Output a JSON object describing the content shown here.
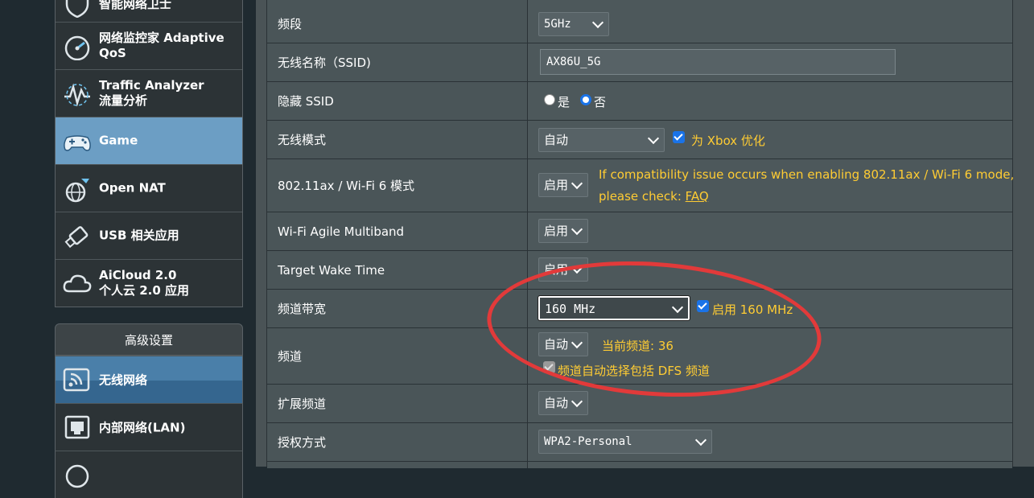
{
  "sidebar": {
    "items": [
      {
        "label": "智能网络卫士",
        "icon": "shield-icon"
      },
      {
        "label": "网络监控家 Adaptive QoS",
        "line1": "网络监控家 Adaptive",
        "line2": "QoS",
        "icon": "speedometer-icon"
      },
      {
        "label": "Traffic Analyzer 流量分析",
        "line1": "Traffic Analyzer",
        "line2": "流量分析",
        "icon": "traffic-analyzer-icon"
      },
      {
        "label": "Game",
        "icon": "gamepad-icon",
        "active": true
      },
      {
        "label": "Open NAT",
        "icon": "open-nat-icon"
      },
      {
        "label": "USB 相关应用",
        "icon": "usb-icon"
      },
      {
        "label": "AiCloud 2.0 个人云 2.0 应用",
        "line1": "AiCloud 2.0",
        "line2": "个人云 2.0 应用",
        "icon": "cloud-icon"
      }
    ],
    "advanced_header": "高级设置",
    "advanced_items": [
      {
        "label": "无线网络",
        "icon": "wireless-icon",
        "active": true
      },
      {
        "label": "内部网络(LAN)",
        "icon": "lan-icon"
      },
      {
        "label": "",
        "icon": "globe-icon"
      }
    ]
  },
  "settings": {
    "band": {
      "label": "频段",
      "value": "5GHz"
    },
    "ssid": {
      "label": "无线名称（SSID)",
      "value": "AX86U_5G"
    },
    "hide_ssid": {
      "label": "隐藏 SSID",
      "yes": "是",
      "no": "否",
      "selected": "否"
    },
    "wireless_mode": {
      "label": "无线模式",
      "value": "自动",
      "xbox_label": "为 Xbox 优化",
      "xbox_checked": true
    },
    "ax_mode": {
      "label": "802.11ax / Wi-Fi 6 模式",
      "value": "启用",
      "note_line1": "If compatibility issue occurs when enabling 802.11ax / Wi-Fi 6 mode,",
      "note_line2_prefix": "please check: ",
      "note_link": "FAQ"
    },
    "agile_multiband": {
      "label": "Wi-Fi Agile Multiband",
      "value": "启用"
    },
    "twt": {
      "label": "Target Wake Time",
      "value": "启用"
    },
    "bandwidth": {
      "label": "频道带宽",
      "value": "160 MHz",
      "enable_160_label": "启用 160 MHz",
      "enable_160_checked": true
    },
    "channel": {
      "label": "频道",
      "value": "自动",
      "current_channel": "当前频道: 36",
      "dfs_label": "频道自动选择包括 DFS 频道",
      "dfs_checked": true
    },
    "ext_channel": {
      "label": "扩展频道",
      "value": "自动"
    },
    "auth": {
      "label": "授权方式",
      "value": "WPA2-Personal"
    }
  },
  "colors": {
    "note_yellow": "#ffcc33",
    "annotation_red": "#e23a3a",
    "active_menu": "#6c9ec4"
  }
}
